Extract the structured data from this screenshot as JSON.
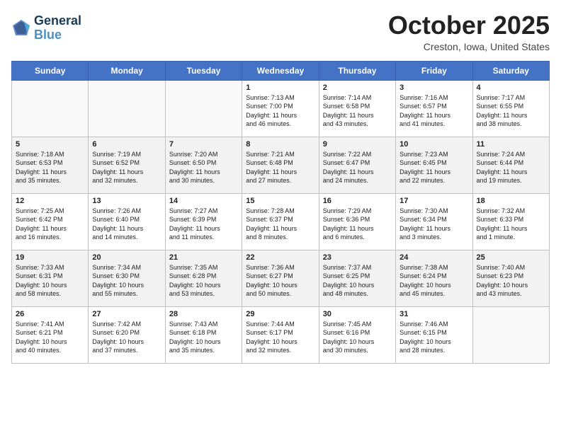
{
  "header": {
    "logo_line1": "General",
    "logo_line2": "Blue",
    "month": "October 2025",
    "location": "Creston, Iowa, United States"
  },
  "weekdays": [
    "Sunday",
    "Monday",
    "Tuesday",
    "Wednesday",
    "Thursday",
    "Friday",
    "Saturday"
  ],
  "weeks": [
    [
      {
        "day": "",
        "info": ""
      },
      {
        "day": "",
        "info": ""
      },
      {
        "day": "",
        "info": ""
      },
      {
        "day": "1",
        "info": "Sunrise: 7:13 AM\nSunset: 7:00 PM\nDaylight: 11 hours\nand 46 minutes."
      },
      {
        "day": "2",
        "info": "Sunrise: 7:14 AM\nSunset: 6:58 PM\nDaylight: 11 hours\nand 43 minutes."
      },
      {
        "day": "3",
        "info": "Sunrise: 7:16 AM\nSunset: 6:57 PM\nDaylight: 11 hours\nand 41 minutes."
      },
      {
        "day": "4",
        "info": "Sunrise: 7:17 AM\nSunset: 6:55 PM\nDaylight: 11 hours\nand 38 minutes."
      }
    ],
    [
      {
        "day": "5",
        "info": "Sunrise: 7:18 AM\nSunset: 6:53 PM\nDaylight: 11 hours\nand 35 minutes."
      },
      {
        "day": "6",
        "info": "Sunrise: 7:19 AM\nSunset: 6:52 PM\nDaylight: 11 hours\nand 32 minutes."
      },
      {
        "day": "7",
        "info": "Sunrise: 7:20 AM\nSunset: 6:50 PM\nDaylight: 11 hours\nand 30 minutes."
      },
      {
        "day": "8",
        "info": "Sunrise: 7:21 AM\nSunset: 6:48 PM\nDaylight: 11 hours\nand 27 minutes."
      },
      {
        "day": "9",
        "info": "Sunrise: 7:22 AM\nSunset: 6:47 PM\nDaylight: 11 hours\nand 24 minutes."
      },
      {
        "day": "10",
        "info": "Sunrise: 7:23 AM\nSunset: 6:45 PM\nDaylight: 11 hours\nand 22 minutes."
      },
      {
        "day": "11",
        "info": "Sunrise: 7:24 AM\nSunset: 6:44 PM\nDaylight: 11 hours\nand 19 minutes."
      }
    ],
    [
      {
        "day": "12",
        "info": "Sunrise: 7:25 AM\nSunset: 6:42 PM\nDaylight: 11 hours\nand 16 minutes."
      },
      {
        "day": "13",
        "info": "Sunrise: 7:26 AM\nSunset: 6:40 PM\nDaylight: 11 hours\nand 14 minutes."
      },
      {
        "day": "14",
        "info": "Sunrise: 7:27 AM\nSunset: 6:39 PM\nDaylight: 11 hours\nand 11 minutes."
      },
      {
        "day": "15",
        "info": "Sunrise: 7:28 AM\nSunset: 6:37 PM\nDaylight: 11 hours\nand 8 minutes."
      },
      {
        "day": "16",
        "info": "Sunrise: 7:29 AM\nSunset: 6:36 PM\nDaylight: 11 hours\nand 6 minutes."
      },
      {
        "day": "17",
        "info": "Sunrise: 7:30 AM\nSunset: 6:34 PM\nDaylight: 11 hours\nand 3 minutes."
      },
      {
        "day": "18",
        "info": "Sunrise: 7:32 AM\nSunset: 6:33 PM\nDaylight: 11 hours\nand 1 minute."
      }
    ],
    [
      {
        "day": "19",
        "info": "Sunrise: 7:33 AM\nSunset: 6:31 PM\nDaylight: 10 hours\nand 58 minutes."
      },
      {
        "day": "20",
        "info": "Sunrise: 7:34 AM\nSunset: 6:30 PM\nDaylight: 10 hours\nand 55 minutes."
      },
      {
        "day": "21",
        "info": "Sunrise: 7:35 AM\nSunset: 6:28 PM\nDaylight: 10 hours\nand 53 minutes."
      },
      {
        "day": "22",
        "info": "Sunrise: 7:36 AM\nSunset: 6:27 PM\nDaylight: 10 hours\nand 50 minutes."
      },
      {
        "day": "23",
        "info": "Sunrise: 7:37 AM\nSunset: 6:25 PM\nDaylight: 10 hours\nand 48 minutes."
      },
      {
        "day": "24",
        "info": "Sunrise: 7:38 AM\nSunset: 6:24 PM\nDaylight: 10 hours\nand 45 minutes."
      },
      {
        "day": "25",
        "info": "Sunrise: 7:40 AM\nSunset: 6:23 PM\nDaylight: 10 hours\nand 43 minutes."
      }
    ],
    [
      {
        "day": "26",
        "info": "Sunrise: 7:41 AM\nSunset: 6:21 PM\nDaylight: 10 hours\nand 40 minutes."
      },
      {
        "day": "27",
        "info": "Sunrise: 7:42 AM\nSunset: 6:20 PM\nDaylight: 10 hours\nand 37 minutes."
      },
      {
        "day": "28",
        "info": "Sunrise: 7:43 AM\nSunset: 6:18 PM\nDaylight: 10 hours\nand 35 minutes."
      },
      {
        "day": "29",
        "info": "Sunrise: 7:44 AM\nSunset: 6:17 PM\nDaylight: 10 hours\nand 32 minutes."
      },
      {
        "day": "30",
        "info": "Sunrise: 7:45 AM\nSunset: 6:16 PM\nDaylight: 10 hours\nand 30 minutes."
      },
      {
        "day": "31",
        "info": "Sunrise: 7:46 AM\nSunset: 6:15 PM\nDaylight: 10 hours\nand 28 minutes."
      },
      {
        "day": "",
        "info": ""
      }
    ]
  ]
}
